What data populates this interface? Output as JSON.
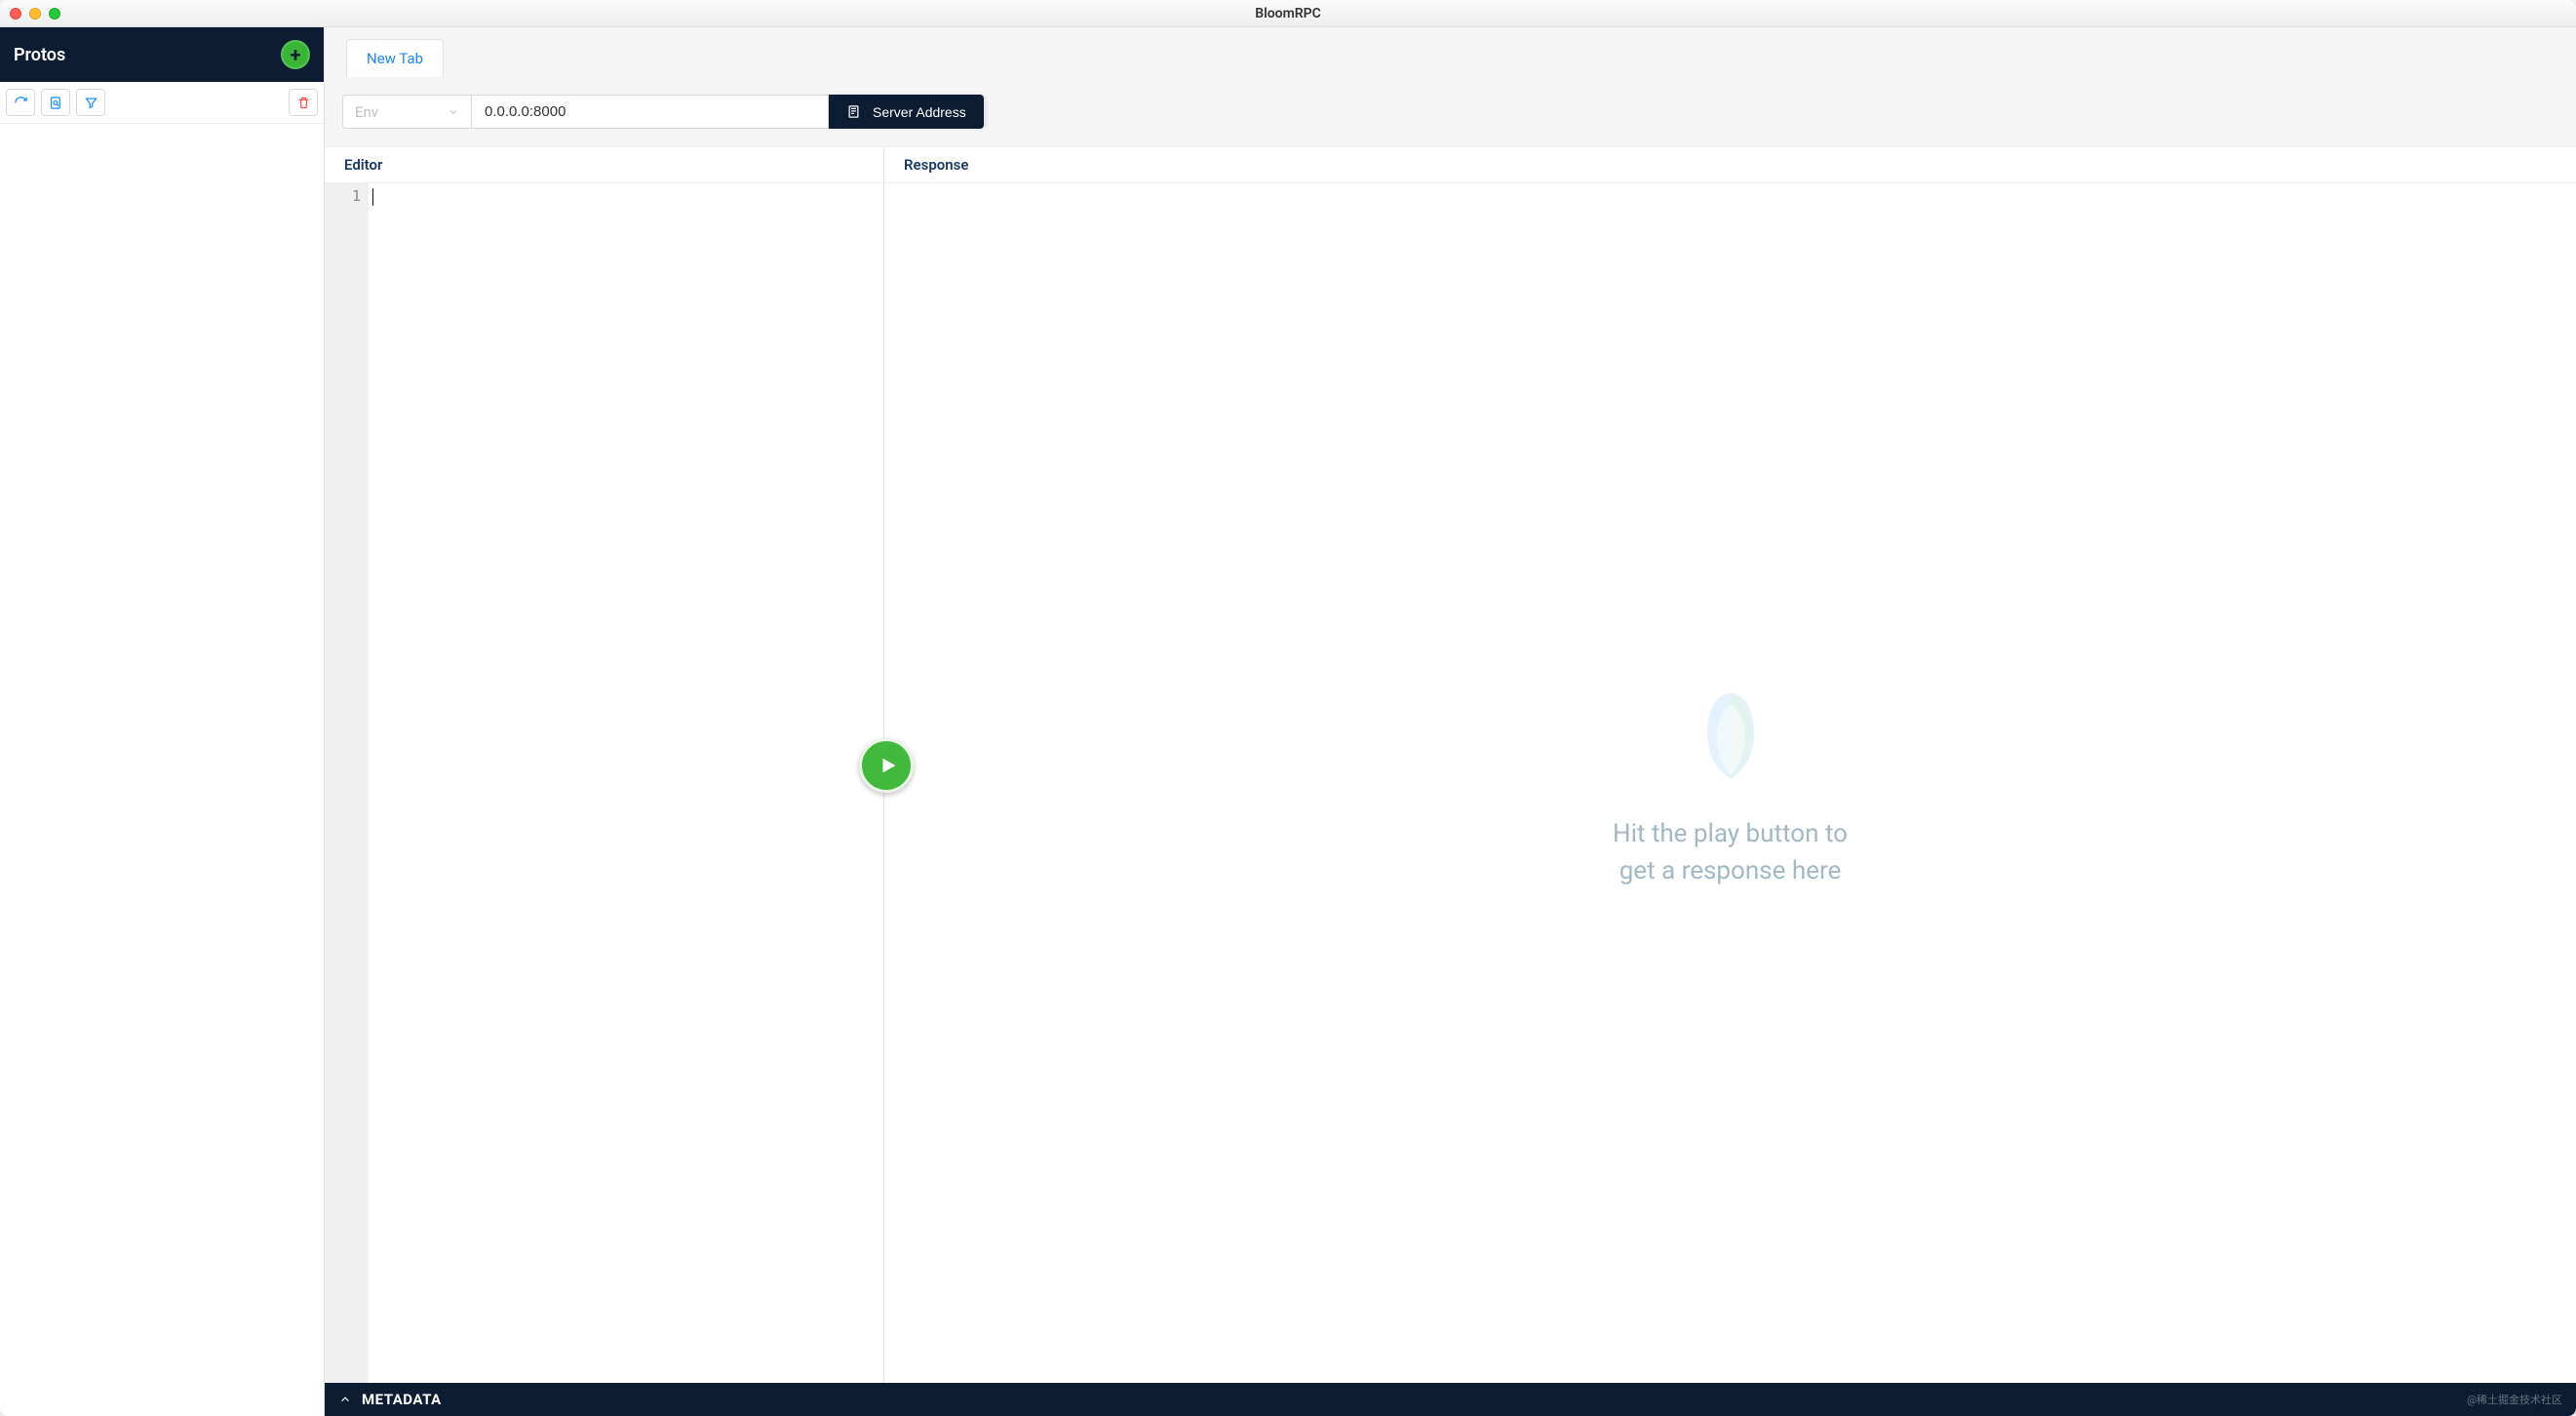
{
  "window": {
    "title": "BloomRPC"
  },
  "sidebar": {
    "title": "Protos"
  },
  "tabs": [
    {
      "label": "New Tab"
    }
  ],
  "toolbar": {
    "env_placeholder": "Env",
    "address_value": "0.0.0.0:8000",
    "address_button": "Server Address"
  },
  "panels": {
    "editor_label": "Editor",
    "response_label": "Response",
    "lines": [
      "1"
    ]
  },
  "response": {
    "placeholder": "Hit the play button to get a response here"
  },
  "footer": {
    "metadata": "METADATA",
    "watermark": "@稀土掘金技术社区"
  }
}
